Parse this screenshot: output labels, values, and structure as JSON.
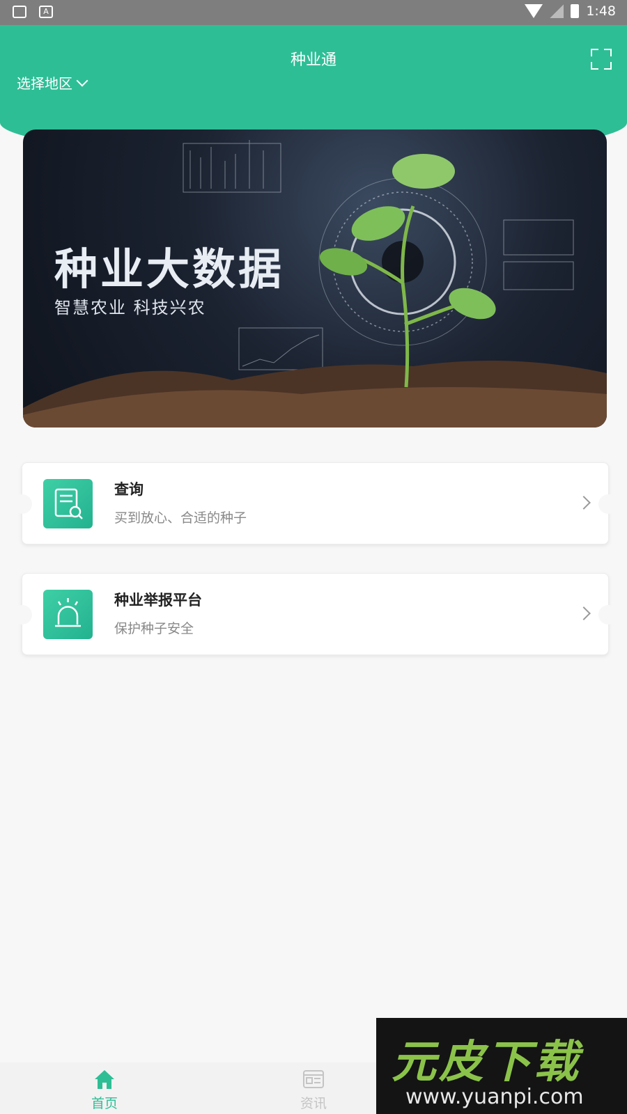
{
  "status_bar": {
    "time": "1:48",
    "icons": [
      "image-icon",
      "a-icon",
      "wifi-icon",
      "no-signal-icon",
      "battery-icon"
    ]
  },
  "header": {
    "title": "种业通",
    "region_label": "选择地区",
    "accent": "#2ebe96"
  },
  "banner": {
    "title": "种业大数据",
    "subtitle": "智慧农业 科技兴农"
  },
  "cards": [
    {
      "title": "查询",
      "subtitle": "买到放心、合适的种子",
      "icon": "document-search-icon"
    },
    {
      "title": "种业举报平台",
      "subtitle": "保护种子安全",
      "icon": "alarm-icon"
    }
  ],
  "tabs": [
    {
      "label": "首页",
      "icon": "home-icon",
      "active": true
    },
    {
      "label": "资讯",
      "icon": "news-icon",
      "active": false
    }
  ],
  "watermark": {
    "text1": "元皮下载",
    "text2": "www.yuanpi.com"
  }
}
